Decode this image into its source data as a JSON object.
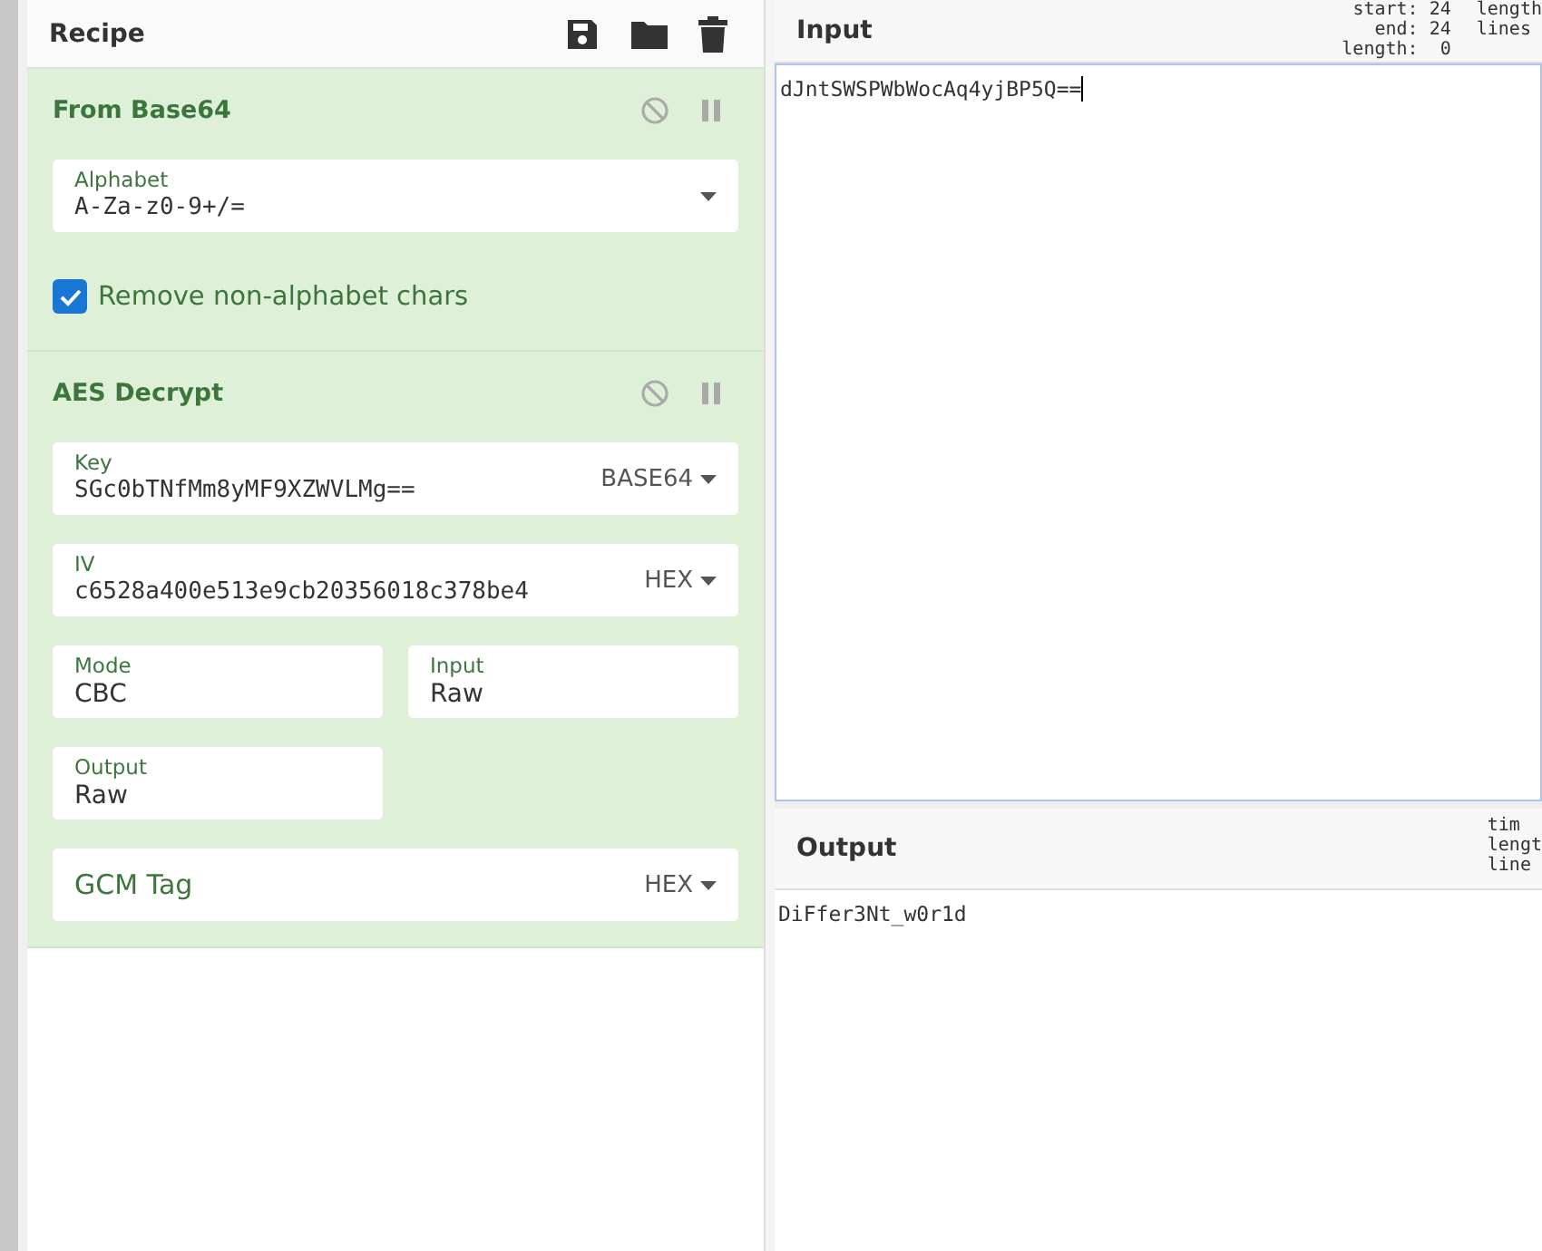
{
  "recipe": {
    "title": "Recipe"
  },
  "operations": [
    {
      "name": "From Base64",
      "args": [
        {
          "kind": "dropdown",
          "label": "Alphabet",
          "value": "A-Za-z0-9+/="
        },
        {
          "kind": "checkbox",
          "label": "Remove non-alphabet chars",
          "checked": true
        }
      ]
    },
    {
      "name": "AES Decrypt",
      "args": [
        {
          "kind": "toggle",
          "label": "Key",
          "value": "SGc0bTNfMm8yMF9XZWVLMg==",
          "option": "BASE64"
        },
        {
          "kind": "toggle",
          "label": "IV",
          "value": "c6528a400e513e9cb20356018c378be4",
          "option": "HEX"
        },
        {
          "kind": "select",
          "label": "Mode",
          "value": "CBC"
        },
        {
          "kind": "select",
          "label": "Input",
          "value": "Raw"
        },
        {
          "kind": "select",
          "label": "Output",
          "value": "Raw"
        },
        {
          "kind": "toggle",
          "label": "GCM Tag",
          "option": "HEX"
        }
      ]
    }
  ],
  "input": {
    "title": "Input",
    "stats": [
      [
        "start: 24",
        "end: 24",
        "length:  0"
      ],
      [
        "length",
        "lines"
      ]
    ],
    "text": "dJntSWSPWbWocAq4yjBP5Q=="
  },
  "output": {
    "title": "Output",
    "stats": [
      [
        "tim",
        "lengt",
        "line"
      ]
    ],
    "text": "DiFfer3Nt_w0r1d"
  }
}
